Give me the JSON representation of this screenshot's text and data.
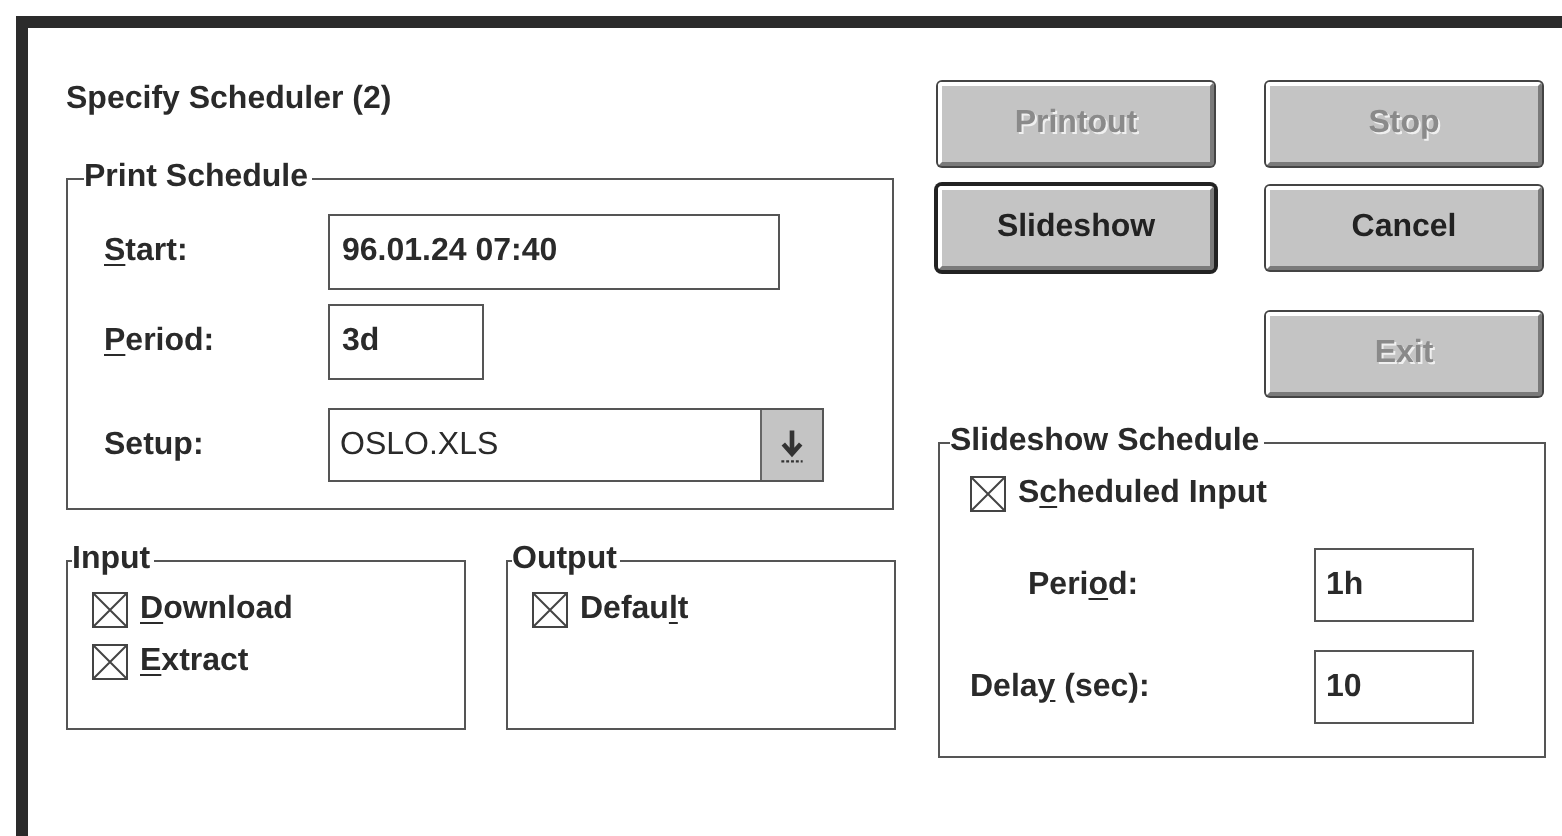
{
  "dialog": {
    "title": "Specify Scheduler (2)"
  },
  "print_schedule": {
    "title": "Print Schedule",
    "fields": [
      {
        "kind": "text",
        "label": [
          {
            "text": "S",
            "underlined": true
          },
          {
            "text": "tart:",
            "underlined": false
          }
        ],
        "value": "96.01.24 07:40"
      },
      {
        "kind": "text",
        "label": [
          {
            "text": "P",
            "underlined": true
          },
          {
            "text": "eriod:",
            "underlined": false
          }
        ],
        "value": "3d"
      },
      {
        "kind": "dropdown",
        "label": [
          {
            "text": "Setup:",
            "underlined": false
          }
        ],
        "value": "OSLO.XLS"
      }
    ]
  },
  "input": {
    "title": "Input",
    "checkboxes": [
      {
        "label": [
          {
            "text": "D",
            "underlined": true
          },
          {
            "text": "ownload",
            "underlined": false
          }
        ],
        "checked": true
      },
      {
        "label": [
          {
            "text": "E",
            "underlined": true
          },
          {
            "text": "xtract",
            "underlined": false
          }
        ],
        "checked": true
      }
    ]
  },
  "output": {
    "title": "Output",
    "checkboxes": [
      {
        "label": [
          {
            "text": "Defau",
            "underlined": false
          },
          {
            "text": "l",
            "underlined": true
          },
          {
            "text": "t",
            "underlined": false
          }
        ],
        "checked": true
      }
    ]
  },
  "buttons": [
    {
      "label": "Printout",
      "disabled": true,
      "default": false
    },
    {
      "label": "Stop",
      "disabled": true,
      "default": false
    },
    {
      "label": "Slideshow",
      "disabled": false,
      "default": true
    },
    {
      "label": "Cancel",
      "disabled": false,
      "default": false
    },
    {
      "label": "Exit",
      "disabled": true,
      "default": false
    }
  ],
  "slideshow_schedule": {
    "title": "Slideshow Schedule",
    "checkbox": {
      "label": [
        {
          "text": "S",
          "underlined": false
        },
        {
          "text": "c",
          "underlined": true
        },
        {
          "text": "heduled Input",
          "underlined": false
        }
      ],
      "checked": true
    },
    "fields": [
      {
        "label": [
          {
            "text": "Peri",
            "underlined": false
          },
          {
            "text": "o",
            "underlined": true
          },
          {
            "text": "d:",
            "underlined": false
          }
        ],
        "value": "1h"
      },
      {
        "label": [
          {
            "text": "Dela",
            "underlined": false
          },
          {
            "text": "y",
            "underlined": true
          },
          {
            "text": " (sec):",
            "underlined": false
          }
        ],
        "value": "10"
      }
    ]
  }
}
